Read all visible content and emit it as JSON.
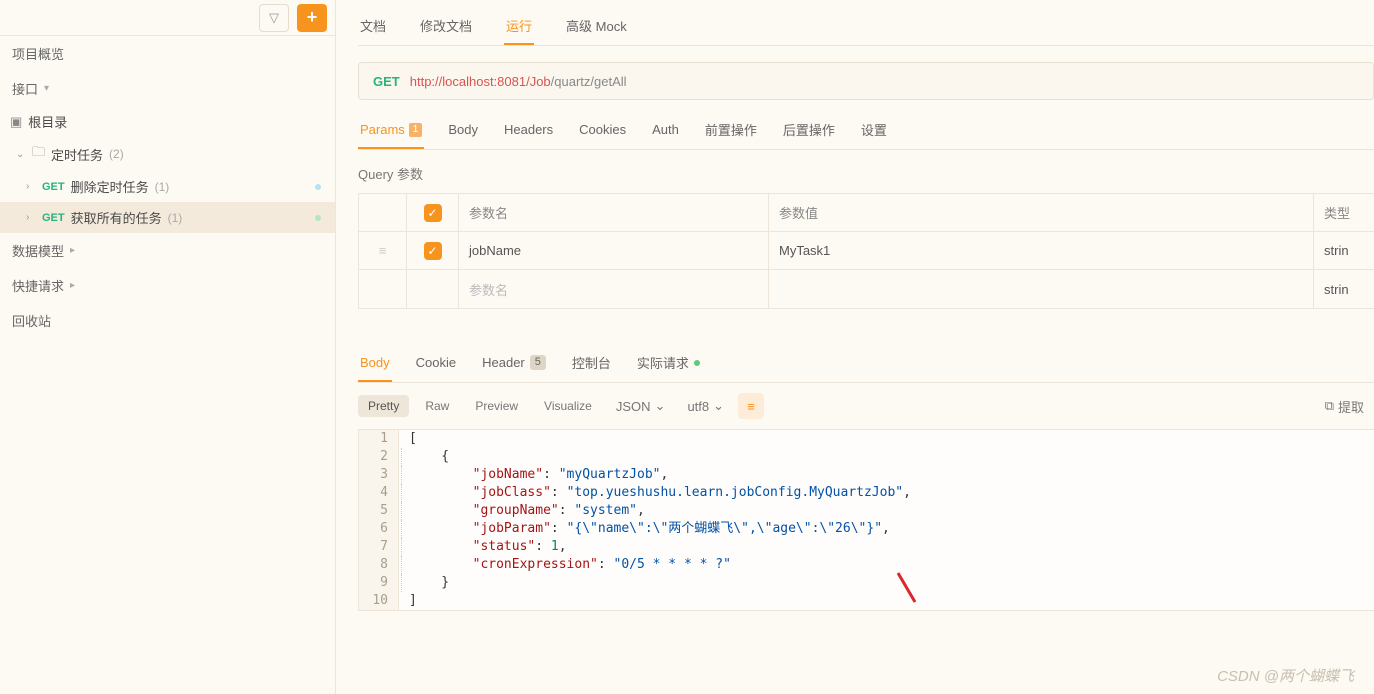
{
  "sidebar": {
    "overview": "项目概览",
    "api": "接口",
    "root": "根目录",
    "folder": {
      "name": "定时任务",
      "count": "(2)"
    },
    "items": [
      {
        "method": "GET",
        "name": "删除定时任务",
        "count": "(1)"
      },
      {
        "method": "GET",
        "name": "获取所有的任务",
        "count": "(1)"
      }
    ],
    "models": "数据模型",
    "quick": "快捷请求",
    "trash": "回收站"
  },
  "topTabs": {
    "doc": "文档",
    "edit": "修改文档",
    "run": "运行",
    "mock": "高级 Mock"
  },
  "request": {
    "method": "GET",
    "host": "http://localhost:8081/Job",
    "path": "/quartz/getAll"
  },
  "subTabs": {
    "params": "Params",
    "paramsBadge": "1",
    "body": "Body",
    "headers": "Headers",
    "cookies": "Cookies",
    "auth": "Auth",
    "pre": "前置操作",
    "post": "后置操作",
    "settings": "设置"
  },
  "query": {
    "title": "Query 参数",
    "head": {
      "name": "参数名",
      "value": "参数值",
      "type": "类型"
    },
    "rows": [
      {
        "name": "jobName",
        "value": "MyTask1",
        "type": "strin"
      }
    ],
    "empty": {
      "name": "参数名",
      "type": "strin"
    }
  },
  "respTabs": {
    "body": "Body",
    "cookie": "Cookie",
    "header": "Header",
    "headerBadge": "5",
    "console": "控制台",
    "actual": "实际请求"
  },
  "toolbar": {
    "pretty": "Pretty",
    "raw": "Raw",
    "preview": "Preview",
    "visualize": "Visualize",
    "format": "JSON",
    "enc": "utf8",
    "extract": "提取"
  },
  "json": {
    "l1": "[",
    "l2": "    {",
    "l3": {
      "k": "\"jobName\"",
      "v": "\"myQuartzJob\""
    },
    "l4": {
      "k": "\"jobClass\"",
      "v": "\"top.yueshushu.learn.jobConfig.MyQuartzJob\""
    },
    "l5": {
      "k": "\"groupName\"",
      "v": "\"system\""
    },
    "l6": {
      "k": "\"jobParam\"",
      "v": "\"{\\\"name\\\":\\\"两个蝴蝶飞\\\",\\\"age\\\":\\\"26\\\"}\""
    },
    "l7": {
      "k": "\"status\"",
      "v": "1"
    },
    "l8": {
      "k": "\"cronExpression\"",
      "v": "\"0/5 * * * * ?\""
    },
    "l9": "    }",
    "l10": "]"
  },
  "watermark": "CSDN @两个蝴蝶飞"
}
